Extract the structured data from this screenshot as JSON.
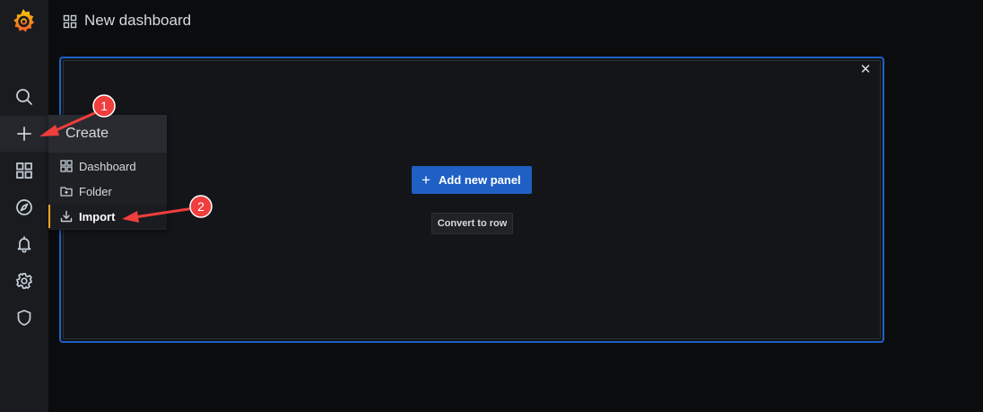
{
  "topbar": {
    "title": "New dashboard",
    "icon": "dashboard-grid-icon"
  },
  "sidemenu": {
    "items": [
      {
        "name": "search",
        "icon": "search-icon"
      },
      {
        "name": "create",
        "icon": "plus-icon"
      },
      {
        "name": "dashboards",
        "icon": "dashboards-grid-icon"
      },
      {
        "name": "explore",
        "icon": "compass-icon"
      },
      {
        "name": "alerting",
        "icon": "bell-icon"
      },
      {
        "name": "configuration",
        "icon": "gear-icon"
      },
      {
        "name": "server-admin",
        "icon": "shield-icon"
      }
    ]
  },
  "create_menu": {
    "header": "Create",
    "items": [
      {
        "label": "Dashboard",
        "icon": "dashboard-grid-icon"
      },
      {
        "label": "Folder",
        "icon": "folder-plus-icon"
      },
      {
        "label": "Import",
        "icon": "import-icon"
      }
    ]
  },
  "panel": {
    "add_button": "Add new panel",
    "convert_button": "Convert to row"
  },
  "annotations": [
    "1",
    "2"
  ],
  "colors": {
    "accent_blue": "#1f60c4",
    "annotation_red": "#f03d3d",
    "active_marker": "#f5a623",
    "background": "#0b0c0e"
  }
}
